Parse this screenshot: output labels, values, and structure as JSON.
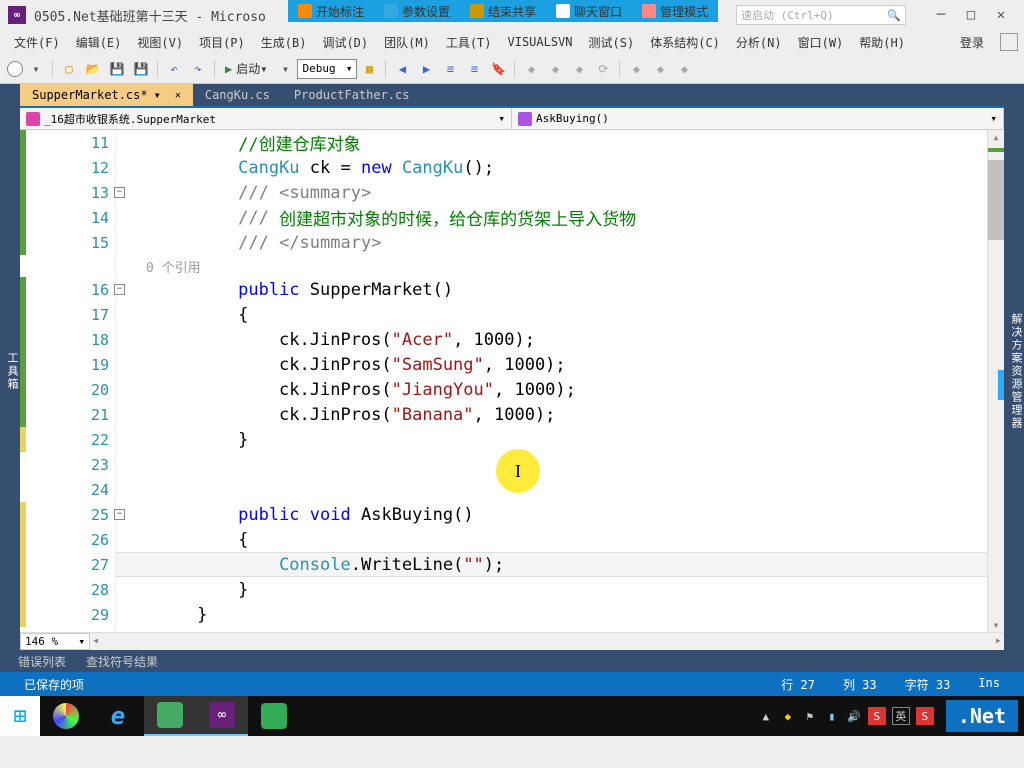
{
  "overlay": {
    "items": [
      "开始标注",
      "参数设置",
      "结束共享",
      "聊天窗口",
      "管理模式"
    ]
  },
  "title": "0505.Net基础班第十三天 - Microso",
  "quicklaunch_placeholder": "速启动 (Ctrl+Q)",
  "menu": {
    "items": [
      "文件(F)",
      "编辑(E)",
      "视图(V)",
      "项目(P)",
      "生成(B)",
      "调试(D)",
      "团队(M)",
      "工具(T)",
      "VISUALSVN",
      "测试(S)",
      "体系结构(C)",
      "分析(N)",
      "窗口(W)",
      "帮助(H)"
    ],
    "login": "登录"
  },
  "toolbar": {
    "start": "启动",
    "config": "Debug"
  },
  "tabs": [
    {
      "label": "SupperMarket.cs*",
      "active": true
    },
    {
      "label": "CangKu.cs",
      "active": false
    },
    {
      "label": "ProductFather.cs",
      "active": false
    }
  ],
  "left_tool": "工具箱",
  "right_tool": "解决方案资源管理器",
  "navbar": {
    "left": "_16超市收银系统.SupperMarket",
    "right": "AskBuying()"
  },
  "references": "0 个引用",
  "code_lines": [
    {
      "n": 11,
      "m": "green",
      "tokens": [
        {
          "t": "         ",
          "c": ""
        },
        {
          "t": "//创建仓库对象",
          "c": "c-comment"
        }
      ]
    },
    {
      "n": 12,
      "m": "green",
      "tokens": [
        {
          "t": "         ",
          "c": ""
        },
        {
          "t": "CangKu",
          "c": "c-type"
        },
        {
          "t": " ck = ",
          "c": ""
        },
        {
          "t": "new",
          "c": "c-keyword"
        },
        {
          "t": " ",
          "c": ""
        },
        {
          "t": "CangKu",
          "c": "c-type"
        },
        {
          "t": "();",
          "c": ""
        }
      ]
    },
    {
      "n": 13,
      "m": "green",
      "fold": true,
      "tokens": [
        {
          "t": "         ",
          "c": ""
        },
        {
          "t": "/// ",
          "c": "c-doc"
        },
        {
          "t": "<summary>",
          "c": "c-doc"
        }
      ]
    },
    {
      "n": 14,
      "m": "green",
      "tokens": [
        {
          "t": "         ",
          "c": ""
        },
        {
          "t": "/// ",
          "c": "c-doc"
        },
        {
          "t": "创建超市对象的时候，给仓库的货架上导入货物",
          "c": "c-comment"
        }
      ]
    },
    {
      "n": 15,
      "m": "green",
      "tokens": [
        {
          "t": "         ",
          "c": ""
        },
        {
          "t": "/// ",
          "c": "c-doc"
        },
        {
          "t": "</summary>",
          "c": "c-doc"
        }
      ]
    },
    {
      "ref": true
    },
    {
      "n": 16,
      "m": "green",
      "fold": true,
      "tokens": [
        {
          "t": "         ",
          "c": ""
        },
        {
          "t": "public",
          "c": "c-keyword"
        },
        {
          "t": " SupperMarket()",
          "c": ""
        }
      ]
    },
    {
      "n": 17,
      "m": "green",
      "tokens": [
        {
          "t": "         {",
          "c": ""
        }
      ]
    },
    {
      "n": 18,
      "m": "green",
      "tokens": [
        {
          "t": "             ck.JinPros(",
          "c": ""
        },
        {
          "t": "\"Acer\"",
          "c": "c-string"
        },
        {
          "t": ", 1000);",
          "c": ""
        }
      ]
    },
    {
      "n": 19,
      "m": "green",
      "tokens": [
        {
          "t": "             ck.JinPros(",
          "c": ""
        },
        {
          "t": "\"SamSung\"",
          "c": "c-string"
        },
        {
          "t": ", 1000);",
          "c": ""
        }
      ]
    },
    {
      "n": 20,
      "m": "green",
      "tokens": [
        {
          "t": "             ck.JinPros(",
          "c": ""
        },
        {
          "t": "\"JiangYou\"",
          "c": "c-string"
        },
        {
          "t": ", 1000);",
          "c": ""
        }
      ]
    },
    {
      "n": 21,
      "m": "green",
      "tokens": [
        {
          "t": "             ck.JinPros(",
          "c": ""
        },
        {
          "t": "\"Banana\"",
          "c": "c-string"
        },
        {
          "t": ", 1000);",
          "c": ""
        }
      ]
    },
    {
      "n": 22,
      "m": "yellow",
      "tokens": [
        {
          "t": "         }",
          "c": ""
        }
      ]
    },
    {
      "n": 23,
      "m": "",
      "tokens": [
        {
          "t": "",
          "c": ""
        }
      ]
    },
    {
      "n": 24,
      "m": "",
      "tokens": [
        {
          "t": "",
          "c": ""
        }
      ]
    },
    {
      "n": 25,
      "m": "yellow",
      "fold": true,
      "tokens": [
        {
          "t": "         ",
          "c": ""
        },
        {
          "t": "public",
          "c": "c-keyword"
        },
        {
          "t": " ",
          "c": ""
        },
        {
          "t": "void",
          "c": "c-keyword"
        },
        {
          "t": " AskBuying()",
          "c": ""
        }
      ]
    },
    {
      "n": 26,
      "m": "yellow",
      "tokens": [
        {
          "t": "         {",
          "c": ""
        }
      ]
    },
    {
      "n": 27,
      "m": "yellow",
      "hl": true,
      "tokens": [
        {
          "t": "             ",
          "c": ""
        },
        {
          "t": "Console",
          "c": "c-type"
        },
        {
          "t": ".WriteLine(",
          "c": ""
        },
        {
          "t": "\"\"",
          "c": "c-string"
        },
        {
          "t": ");",
          "c": ""
        }
      ]
    },
    {
      "n": 28,
      "m": "yellow",
      "tokens": [
        {
          "t": "         }",
          "c": ""
        }
      ]
    },
    {
      "n": 29,
      "m": "yellow",
      "tokens": [
        {
          "t": "     }",
          "c": ""
        }
      ]
    }
  ],
  "zoom": "146 %",
  "bottom": {
    "items": [
      "错误列表",
      "查找符号结果"
    ]
  },
  "status": {
    "left": "已保存的项",
    "line": "行 27",
    "col": "列 33",
    "char": "字符 33",
    "ins": "Ins"
  },
  "net_badge": ".Net"
}
